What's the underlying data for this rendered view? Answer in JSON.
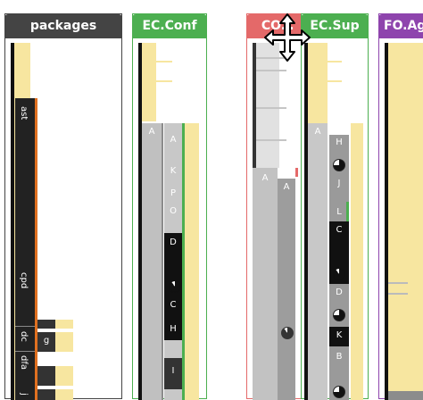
{
  "columns": [
    {
      "id": "packages",
      "title": "packages",
      "color": "#444444",
      "bars": [
        "ast",
        "cpd",
        "dc",
        "dfa",
        "j"
      ],
      "sub_bars": [
        "g",
        "g"
      ]
    },
    {
      "id": "ec_conf",
      "title": "EC.Conf",
      "color": "#4caf50",
      "letters": [
        "A",
        "K",
        "P",
        "O",
        "D",
        "C",
        "H",
        "I"
      ]
    },
    {
      "id": "ec_core",
      "title": "CO…",
      "color": "#e05050",
      "letters": [
        "A",
        "A"
      ]
    },
    {
      "id": "ec_sup",
      "title": "EC.Sup",
      "color": "#4caf50",
      "letters": [
        "A",
        "H",
        "J",
        "L",
        "C",
        "D",
        "K",
        "B"
      ]
    },
    {
      "id": "fo_ag",
      "title": "FO.Ag",
      "color": "#8e44ad",
      "letters": []
    }
  ],
  "colors": {
    "yellow": "#f7e6a0",
    "dark": "#222222",
    "mid": "#8c8c8c",
    "light": "#c8c8c8",
    "orange": "#e07020",
    "green": "#4caf50",
    "red": "#e05050",
    "purple": "#8e44ad"
  },
  "icons": {
    "move": "move-cross-icon"
  }
}
